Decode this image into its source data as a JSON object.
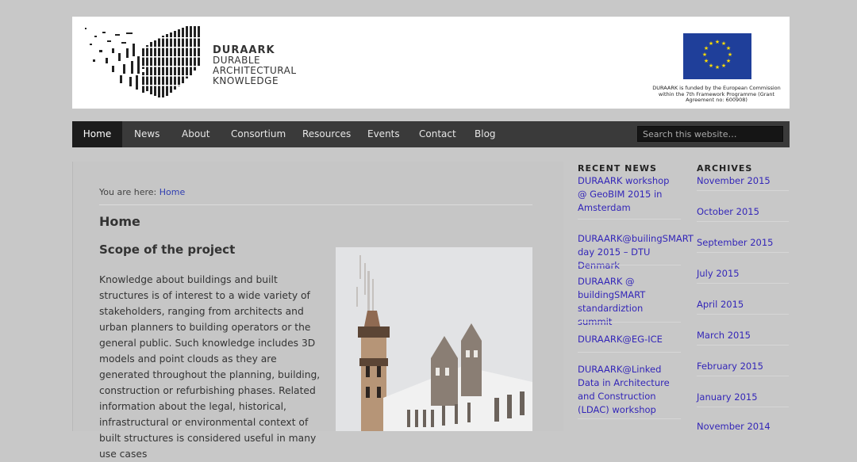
{
  "header": {
    "logo_line1": "DURAARK",
    "logo_line2": "DURABLE",
    "logo_line3": "ARCHITECTURAL",
    "logo_line4": "KNOWLEDGE",
    "eu_caption": "DURAARK is funded by the European Commission within the 7th Framework Programme (Grant Agreement no: 600908)"
  },
  "nav": {
    "items": [
      "Home",
      "News",
      "About",
      "Consortium",
      "Resources",
      "Events",
      "Contact",
      "Blog"
    ],
    "active": "Home",
    "search_placeholder": "Search this website…"
  },
  "main": {
    "breadcrumb_prefix": "You are here:",
    "breadcrumb_link": "Home",
    "page_title": "Home",
    "section_title": "Scope of the project",
    "body": "Knowledge about buildings and built structures is of interest to a wide variety of stakeholders, ranging from architects and urban planners to building operators or the general public. Such knowledge includes 3D models and point clouds as they are generated throughout the planning, building, construction or refurbishing phases. Related information about the legal, historical, infrastructural or environmental context of built structures is considered useful in many use cases"
  },
  "sidebar": {
    "recent_news_title": "RECENT NEWS",
    "recent_news": [
      "DURAARK workshop @ GeoBIM 2015 in Amsterdam",
      "DURAARK@builingSMART day 2015 – DTU Denmark",
      "DURAARK @ buildingSMART standardiztion summit",
      "DURAARK@EG-ICE",
      "DURAARK@Linked Data in Architecture and Construction (LDAC) workshop"
    ],
    "archives_title": "ARCHIVES",
    "archives": [
      "November 2015",
      "October 2015",
      "September 2015",
      "July 2015",
      "April 2015",
      "March 2015",
      "February 2015",
      "January 2015",
      "November 2014"
    ]
  },
  "colors": {
    "background": "#c8c8c8",
    "nav_bg": "#3a3a3a",
    "nav_active": "#1c1c1c",
    "link": "#3326b8",
    "eu_blue": "#1f3f9a",
    "eu_star": "#ffdd00"
  }
}
